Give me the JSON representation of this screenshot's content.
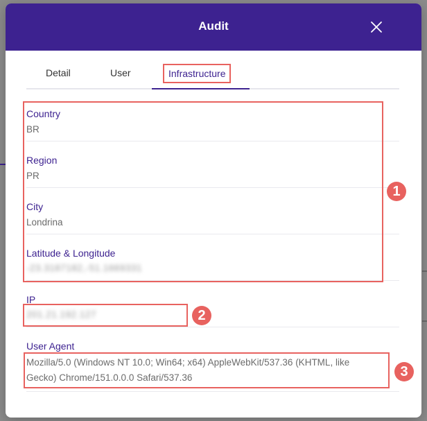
{
  "modal": {
    "title": "Audit",
    "close_icon": "close-icon"
  },
  "tabs": [
    {
      "label": "Detail"
    },
    {
      "label": "User"
    },
    {
      "label": "Infrastructure",
      "active": true
    }
  ],
  "fields": {
    "country": {
      "label": "Country",
      "value": "BR"
    },
    "region": {
      "label": "Region",
      "value": "PR"
    },
    "city": {
      "label": "City",
      "value": "Londrina"
    },
    "latlng": {
      "label": "Latitude & Longitude",
      "value": "-23.3187182,-51.1669331"
    },
    "ip": {
      "label": "IP",
      "value": "201.21.192.127"
    },
    "user_agent": {
      "label": "User Agent",
      "value": "Mozilla/5.0 (Windows NT 10.0; Win64; x64) AppleWebKit/537.36 (KHTML, like Gecko) Chrome/151.0.0.0 Safari/537.36"
    }
  },
  "annotations": {
    "badge_1": "1",
    "badge_2": "2",
    "badge_3": "3",
    "color": "#e8625f"
  },
  "colors": {
    "brand": "#3d2290",
    "label": "#3d2290",
    "value": "#6b6b6b"
  }
}
